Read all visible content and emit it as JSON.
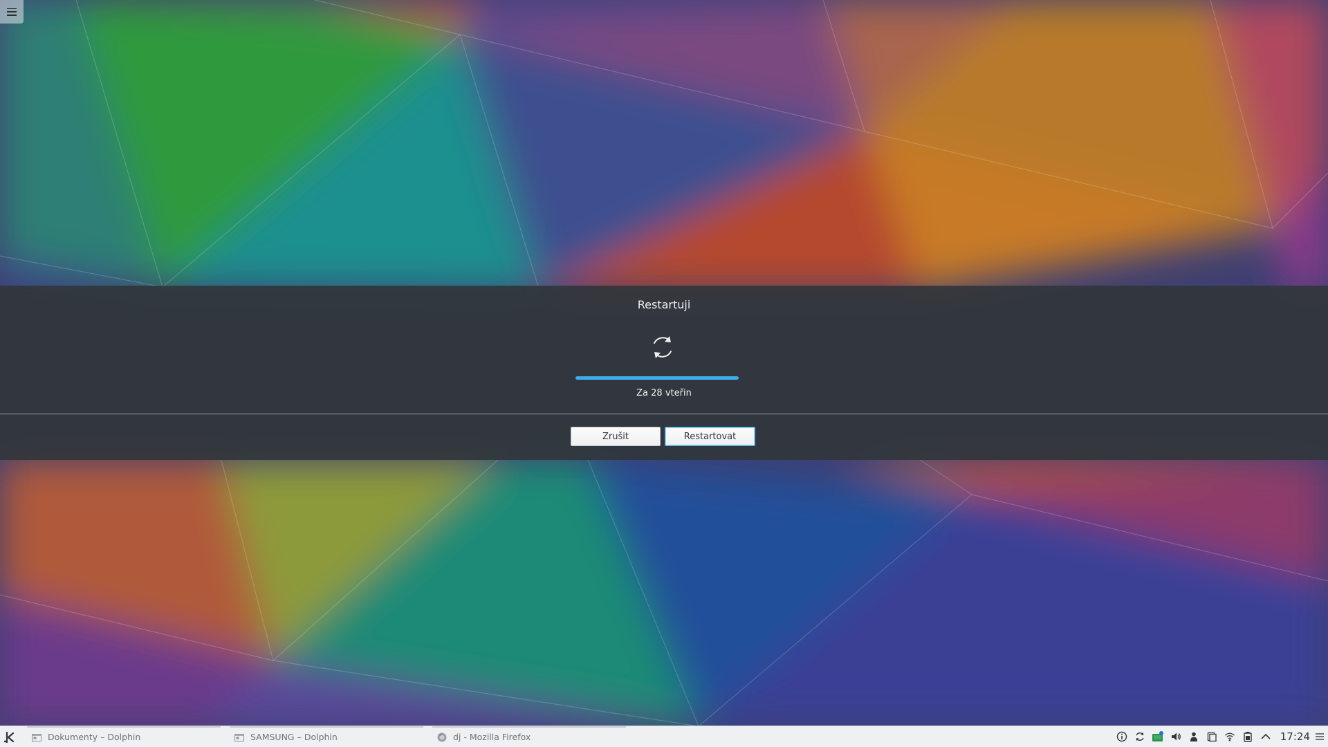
{
  "desktop": {
    "menu_icon": "hamburger-icon"
  },
  "logout_dialog": {
    "title": "Restartuji",
    "icon": "restart-icon",
    "progress": 1.0,
    "accent_color": "#3daee9",
    "countdown": "Za 28 vteřin",
    "cancel_label": "Zrušit",
    "confirm_label": "Restartovat"
  },
  "taskbar": {
    "launcher_icon": "kde-launcher-icon",
    "tasks": [
      {
        "label": "Dokumenty – Dolphin",
        "icon": "folder-window-icon"
      },
      {
        "label": "SAMSUNG – Dolphin",
        "icon": "folder-window-icon"
      },
      {
        "label": "dj - Mozilla Firefox",
        "icon": "firefox-icon"
      }
    ],
    "tray_icons": [
      "info-icon",
      "update-icon",
      "device-notifier-icon",
      "volume-icon",
      "user-icon",
      "clipboard-icon",
      "wifi-icon",
      "battery-icon",
      "expand-tray-icon"
    ],
    "clock": "17:24",
    "panel_menu_icon": "panel-menu-icon"
  }
}
